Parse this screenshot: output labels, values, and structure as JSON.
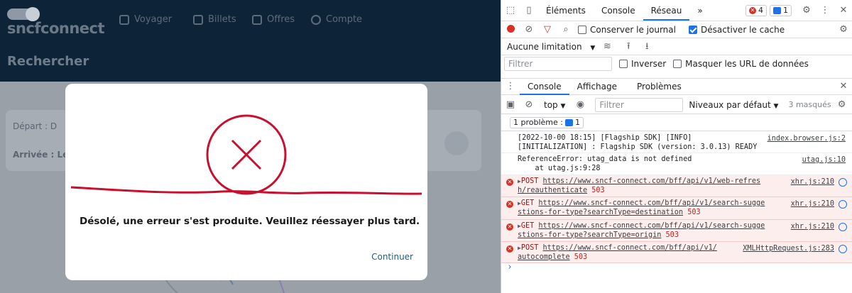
{
  "site": {
    "logo_text": "sncfconnect",
    "nav": [
      {
        "label": "Voyager",
        "icon": "map-icon"
      },
      {
        "label": "Billets",
        "icon": "ticket-icon"
      },
      {
        "label": "Offres",
        "icon": "offers-icon"
      },
      {
        "label": "Compte",
        "icon": "account-icon"
      }
    ],
    "page_title": "Rechercher",
    "depart_label": "Départ : D",
    "arrivee_label": "Arrivée : Le",
    "colors": {
      "header": "#0d2438",
      "overlay": "#9aa0a8",
      "brand_red": "#c8102e"
    }
  },
  "modal": {
    "icon": "error-circle-icon",
    "message": "Désolé, une erreur s'est produite. Veuillez réessayer plus tard.",
    "continue_label": "Continuer"
  },
  "devtools": {
    "tabs": [
      "Éléments",
      "Console",
      "Réseau"
    ],
    "active_tab": "Réseau",
    "more_tabs": "»",
    "error_count": "4",
    "message_count": "1",
    "network": {
      "preserve_log_label": "Conserver le journal",
      "disable_cache_label": "Désactiver le cache",
      "throttling": "Aucune limitation",
      "filter_placeholder": "Filtrer",
      "invert_label": "Inverser",
      "hide_urls_label": "Masquer les URL de données"
    },
    "drawer_tabs": [
      "Console",
      "Affichage",
      "Problèmes"
    ],
    "console": {
      "context": "top",
      "filter_placeholder": "Filtrer",
      "levels": "Niveaux par défaut",
      "hidden": "3 masqués",
      "issues": "1 problème :",
      "issues_count": "1",
      "logs": [
        {
          "type": "info",
          "line1": "[2022-10-00 18:15] [Flagship SDK] [INFO]",
          "line2": "[INITIALIZATION] : Flagship SDK (version: 3.0.13) READY",
          "source": "index.browser.js:2"
        },
        {
          "type": "info",
          "line1": "ReferenceError: utag_data is not defined",
          "line2": "    at utag.js:9:28",
          "source": "utag.js:10"
        },
        {
          "type": "error",
          "method": "POST",
          "url1": "https://www.sncf-connect.com/bff/api/v1/web-refres",
          "url2": "h/reauthenticate",
          "status": "503",
          "source": "xhr.js:210"
        },
        {
          "type": "error",
          "method": "GET",
          "url1": "https://www.sncf-connect.com/bff/api/v1/search-sugge",
          "url2": "stions-for-type?searchType=destination",
          "status": "503",
          "source": "xhr.js:210"
        },
        {
          "type": "error",
          "method": "GET",
          "url1": "https://www.sncf-connect.com/bff/api/v1/search-sugge",
          "url2": "stions-for-type?searchType=origin",
          "status": "503",
          "source": "xhr.js:210"
        },
        {
          "type": "error",
          "method": "POST",
          "url1": "https://www.sncf-connect.com/bff/api/v1/",
          "url2": "autocomplete",
          "status": "503",
          "source": "XMLHttpRequest.js:283"
        }
      ],
      "prompt": "›"
    }
  }
}
